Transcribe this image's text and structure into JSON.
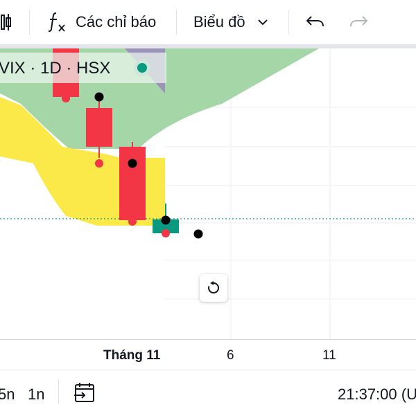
{
  "toolbar": {
    "indicators_label": "Các chỉ báo",
    "chart_type_label": "Biểu đồ"
  },
  "legend": {
    "symbol_text": "VIX · 1D · HSX",
    "status_color": "#089981"
  },
  "xaxis": {
    "labels": [
      "Tháng 11",
      "6",
      "11"
    ]
  },
  "bottom": {
    "intervals": [
      "5n",
      "1n"
    ],
    "clock": "21:37:00 (U"
  },
  "colors": {
    "up_candle": "#089981",
    "down_candle": "#f23645",
    "cloud_green": "#a5d6a7",
    "cloud_yellow": "#fbe94a",
    "cloud_purple": "#9c93b8"
  },
  "icons": {
    "layout": "layout-icon",
    "indicators": "fx-icon",
    "chevron": "chevron-down-icon",
    "undo": "undo-icon",
    "redo": "redo-icon",
    "reset": "reset-icon",
    "goto_date": "calendar-icon"
  }
}
